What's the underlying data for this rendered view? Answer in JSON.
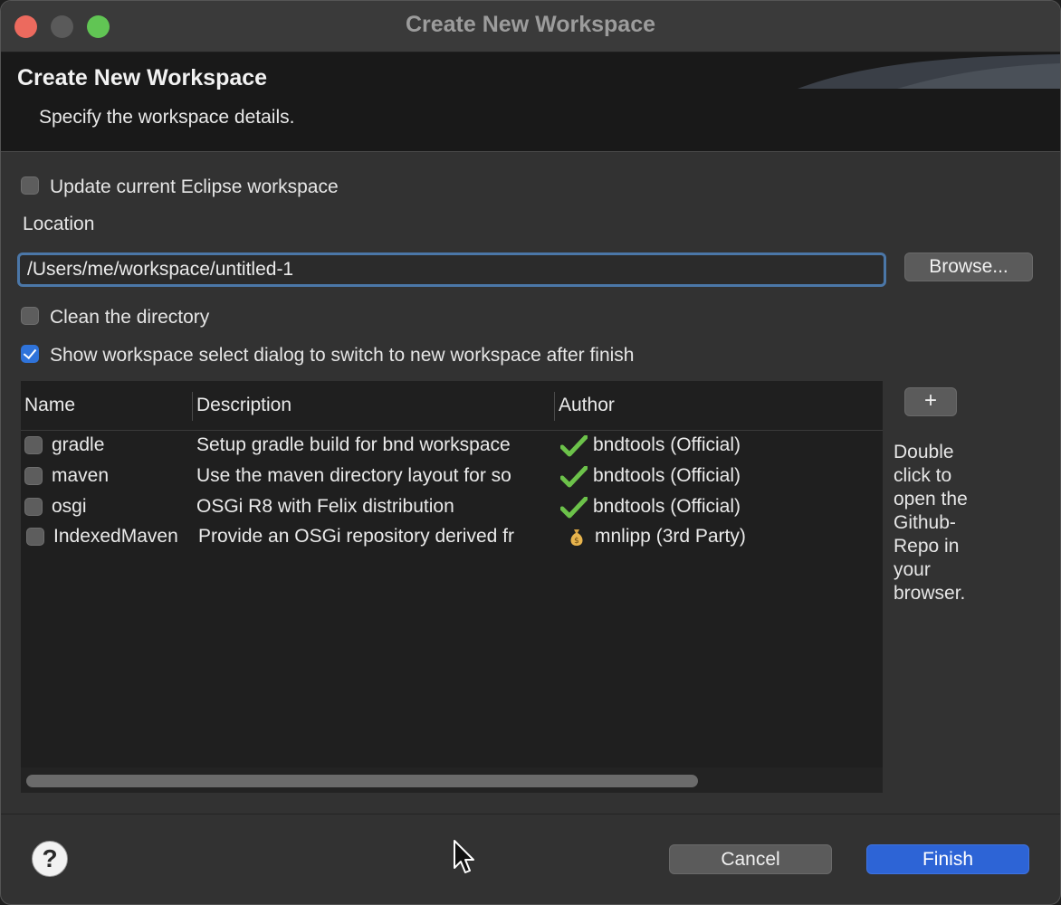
{
  "window": {
    "title": "Create New Workspace"
  },
  "header": {
    "title": "Create New Workspace",
    "description": "Specify the workspace details."
  },
  "form": {
    "update_current_label": "Update current Eclipse workspace",
    "update_current_checked": false,
    "location_label": "Location",
    "location_value": "/Users/me/workspace/untitled-1",
    "browse_label": "Browse...",
    "clean_label": "Clean the directory",
    "clean_checked": false,
    "show_dialog_label": "Show workspace select dialog to switch to new workspace after finish",
    "show_dialog_checked": true
  },
  "table": {
    "columns": [
      "Name",
      "Description",
      "Author"
    ],
    "rows": [
      {
        "name": "gradle",
        "description": "Setup gradle build for bnd workspace",
        "author": "bndtools (Official)",
        "author_icon": "checkmark-icon",
        "checked": false
      },
      {
        "name": "maven",
        "description": "Use the maven directory layout for so",
        "author": "bndtools (Official)",
        "author_icon": "checkmark-icon",
        "checked": false
      },
      {
        "name": "osgi",
        "description": "OSGi R8 with Felix distribution",
        "author": "bndtools (Official)",
        "author_icon": "checkmark-icon",
        "checked": false
      },
      {
        "name": "IndexedMaven",
        "description": "Provide an OSGi repository derived fr",
        "author": "mnlipp (3rd Party)",
        "author_icon": "money-bag-icon",
        "checked": false
      }
    ]
  },
  "side": {
    "add_label": "+",
    "note": "Double click to open the Github-Repo in your browser."
  },
  "footer": {
    "help_label": "?",
    "cancel_label": "Cancel",
    "finish_label": "Finish"
  },
  "colors": {
    "accent": "#2d64d6",
    "check_green": "#6cc24a"
  }
}
